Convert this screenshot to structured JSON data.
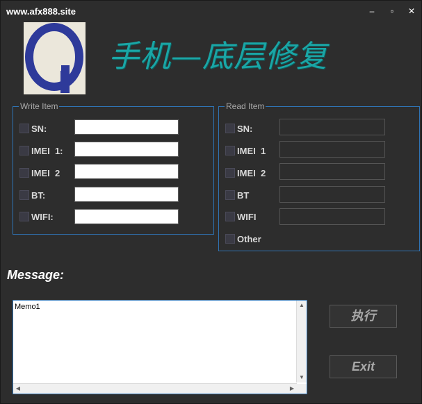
{
  "window": {
    "title": "www.afx888.site",
    "minimize_glyph": "–",
    "maximize_glyph": "▫",
    "close_glyph": "✕"
  },
  "brand": {
    "logo_icon": "q-logo-icon",
    "text": "手机—底层修复",
    "color": "#1aa6a6"
  },
  "write_item": {
    "title": "Write Item",
    "fields": [
      {
        "label": "SN:",
        "value": ""
      },
      {
        "label": "IMEI  1:",
        "value": ""
      },
      {
        "label": "IMEI  2",
        "value": ""
      },
      {
        "label": "BT:",
        "value": ""
      },
      {
        "label": "WIFI:",
        "value": ""
      }
    ]
  },
  "read_item": {
    "title": "Read Item",
    "fields": [
      {
        "label": "SN:",
        "value": ""
      },
      {
        "label": "IMEI  1",
        "value": ""
      },
      {
        "label": "IMEI  2",
        "value": ""
      },
      {
        "label": "BT",
        "value": ""
      },
      {
        "label": "WIFI",
        "value": ""
      }
    ],
    "other_label": "Other"
  },
  "message": {
    "label": "Message:",
    "memo_text": "Memo1"
  },
  "buttons": {
    "execute_label": "执行",
    "exit_label": "Exit"
  },
  "accent_color": "#2f74b5"
}
